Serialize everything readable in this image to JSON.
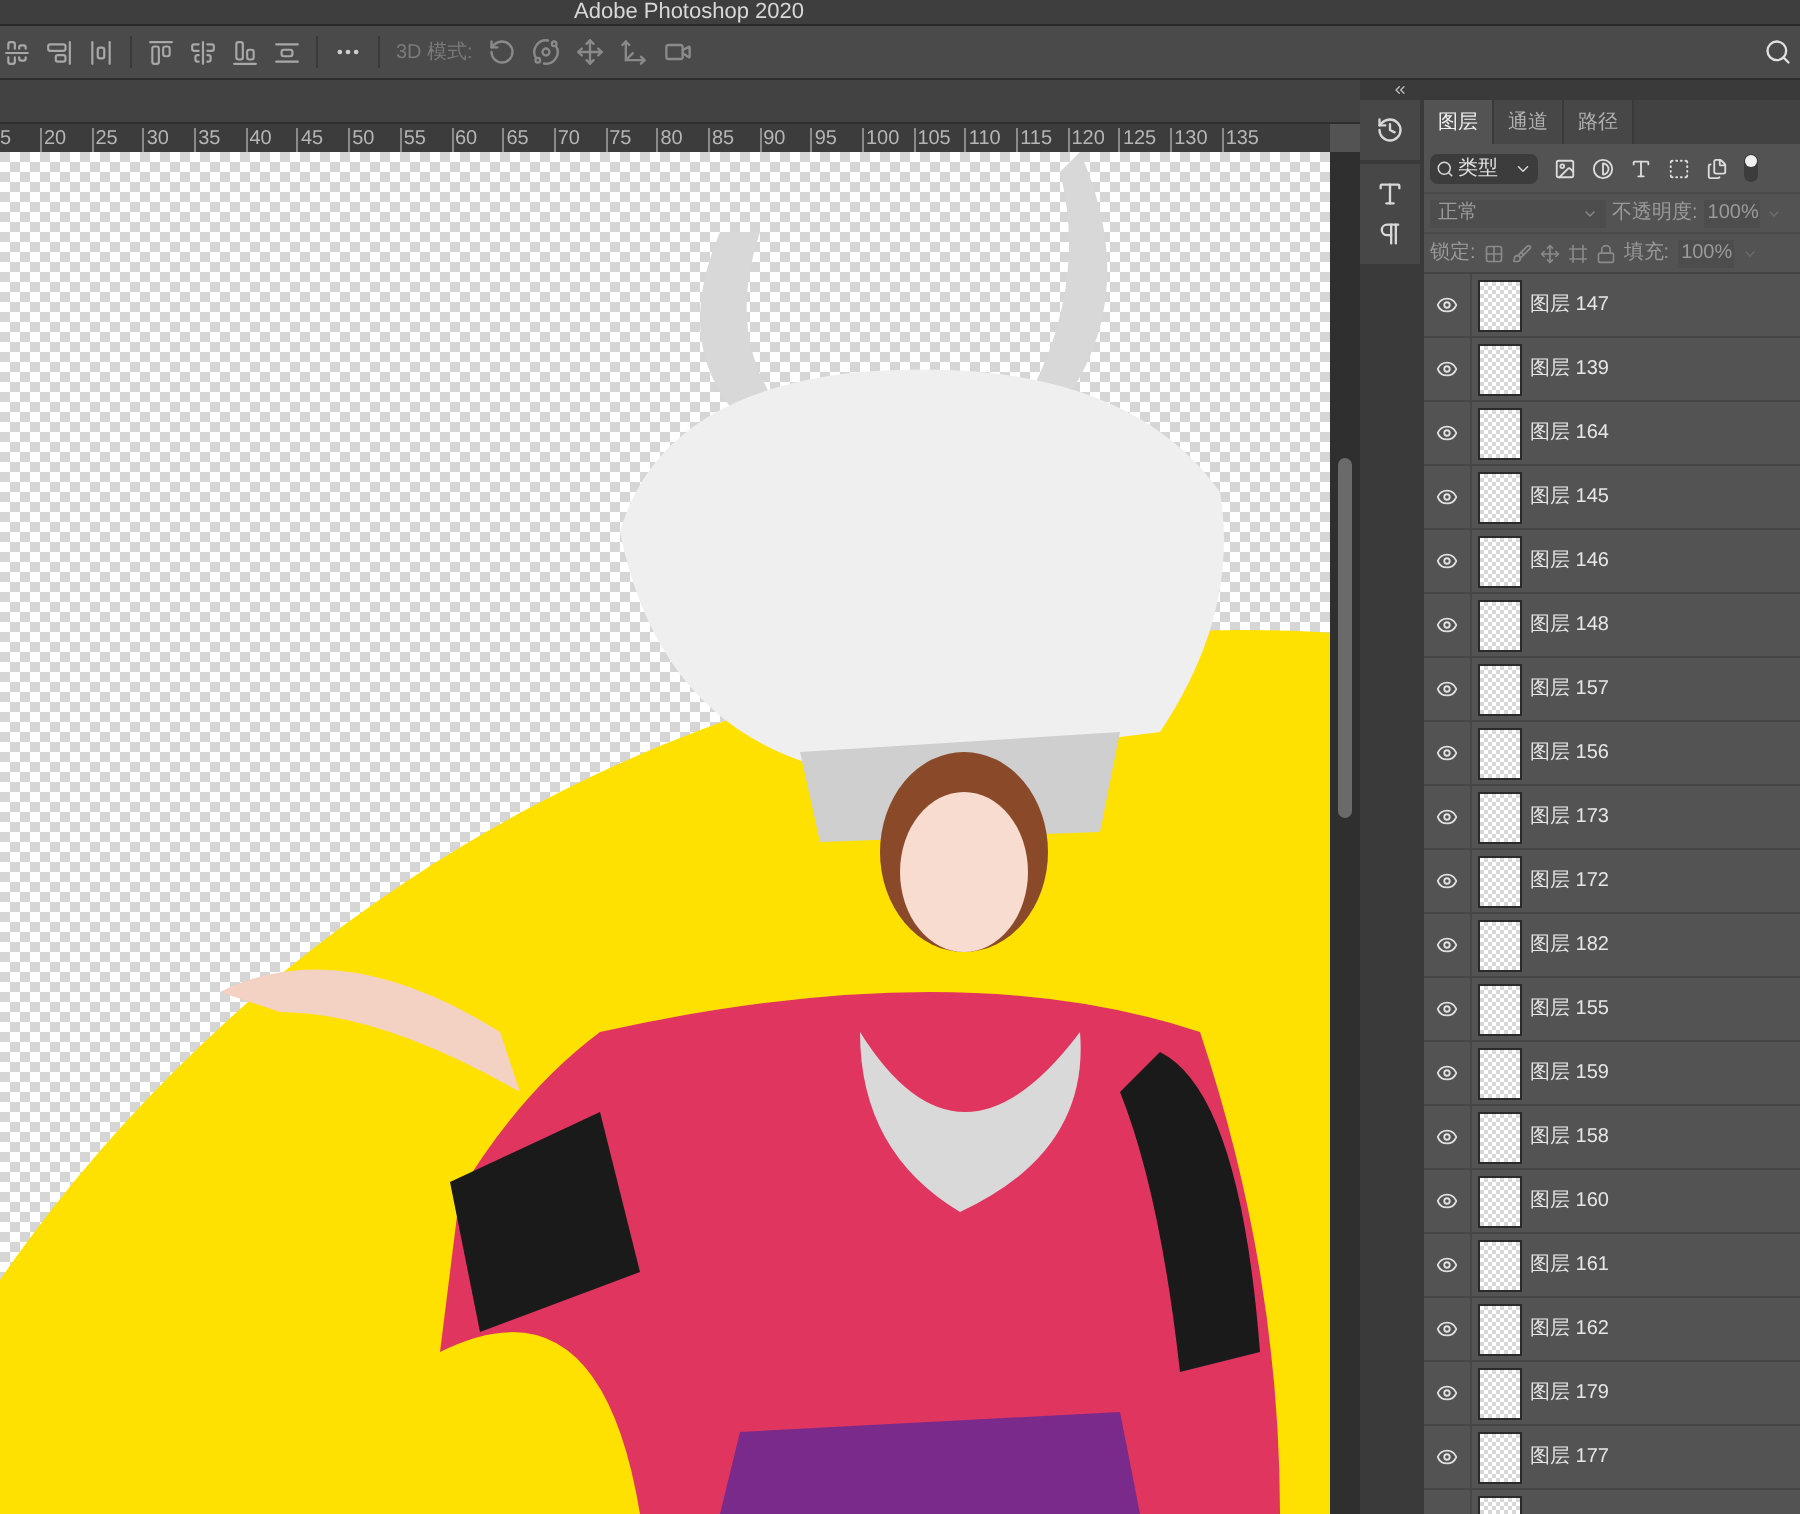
{
  "window": {
    "title": "Adobe Photoshop 2020"
  },
  "options_bar": {
    "mode_label": "3D 模式:"
  },
  "ruler": {
    "labels": [
      "5",
      "20",
      "25",
      "30",
      "35",
      "40",
      "45",
      "50",
      "55",
      "60",
      "65",
      "70",
      "75",
      "80",
      "85",
      "90",
      "95",
      "100",
      "105",
      "110",
      "115",
      "120",
      "125",
      "130",
      "135"
    ]
  },
  "layers_panel": {
    "tabs": [
      {
        "label": "图层",
        "selected": true
      },
      {
        "label": "通道",
        "selected": false
      },
      {
        "label": "路径",
        "selected": false
      }
    ],
    "filter": {
      "value": "类型"
    },
    "blend": {
      "mode": "正常",
      "opacity_label": "不透明度:",
      "opacity": "100%",
      "disabled": true
    },
    "lock": {
      "label": "锁定:",
      "fill_label": "填充:",
      "fill": "100%"
    },
    "layers": [
      {
        "name": "图层 147",
        "visible": true
      },
      {
        "name": "图层 139",
        "visible": true
      },
      {
        "name": "图层 164",
        "visible": true
      },
      {
        "name": "图层 145",
        "visible": true
      },
      {
        "name": "图层 146",
        "visible": true
      },
      {
        "name": "图层 148",
        "visible": true
      },
      {
        "name": "图层 157",
        "visible": true
      },
      {
        "name": "图层 156",
        "visible": true
      },
      {
        "name": "图层 173",
        "visible": true
      },
      {
        "name": "图层 172",
        "visible": true
      },
      {
        "name": "图层 182",
        "visible": true
      },
      {
        "name": "图层 155",
        "visible": true
      },
      {
        "name": "图层 159",
        "visible": true
      },
      {
        "name": "图层 158",
        "visible": true
      },
      {
        "name": "图层 160",
        "visible": true
      },
      {
        "name": "图层 161",
        "visible": true
      },
      {
        "name": "图层 162",
        "visible": true
      },
      {
        "name": "图层 179",
        "visible": true
      },
      {
        "name": "图层 177",
        "visible": true
      }
    ]
  }
}
